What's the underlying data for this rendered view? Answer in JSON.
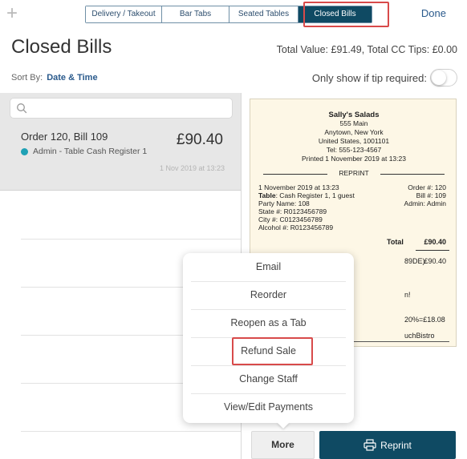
{
  "toolbar": {
    "add_glyph": "+",
    "tabs": [
      {
        "label": "Delivery / Takeout",
        "active": false
      },
      {
        "label": "Bar Tabs",
        "active": false
      },
      {
        "label": "Seated Tables",
        "active": false
      },
      {
        "label": "Closed Bills",
        "active": true
      }
    ],
    "done_label": "Done"
  },
  "header": {
    "title": "Closed Bills",
    "totals": "Total Value: £91.49, Total CC Tips: £0.00"
  },
  "sort": {
    "label": "Sort By:",
    "value": "Date & Time",
    "tip_filter_label": "Only show if tip required:",
    "tip_filter_on": false
  },
  "search": {
    "placeholder": ""
  },
  "orders": [
    {
      "name": "Order 120, Bill 109",
      "staff": "Admin - Table Cash Register 1",
      "amount": "£90.40",
      "date": "1 Nov 2019 at 13:23"
    }
  ],
  "receipt": {
    "restaurant": "Sally's Salads",
    "address1": "555 Main",
    "address2": "Anytown, New York",
    "address3": "United States, 1001101",
    "tel": "Tel: 555-123-4567",
    "printed": "Printed 1 November 2019 at 13:23",
    "reprint_label": "REPRINT",
    "date": "1 November 2019 at 13:23",
    "order_no": "Order #: 120",
    "table_label": "Table",
    "table_value": ": Cash Register 1, 1 guest",
    "bill_no": "Bill #: 109",
    "party": "Party Name: 108",
    "admin": "Admin: Admin",
    "state": "State #: R0123456789",
    "city": "City #: C0123456789",
    "alcohol": "Alcohol #: R0123456789",
    "total_label": "Total",
    "total_value": "£90.40",
    "line_frag": "89DE)",
    "line_value": "£90.40",
    "frag2": "n!",
    "frag3": "20%=£18.08",
    "frag4": "uchBistro"
  },
  "menu": {
    "items": [
      "Email",
      "Reorder",
      "Reopen as a Tab",
      "Refund Sale",
      "Change Staff",
      "View/Edit Payments"
    ]
  },
  "actions": {
    "more_label": "More",
    "reprint_label": "Reprint"
  },
  "colors": {
    "accent": "#0f4a63",
    "highlight": "#d84a4a",
    "status_dot": "#1fa1b5",
    "receipt_bg": "#fdf7e6"
  }
}
